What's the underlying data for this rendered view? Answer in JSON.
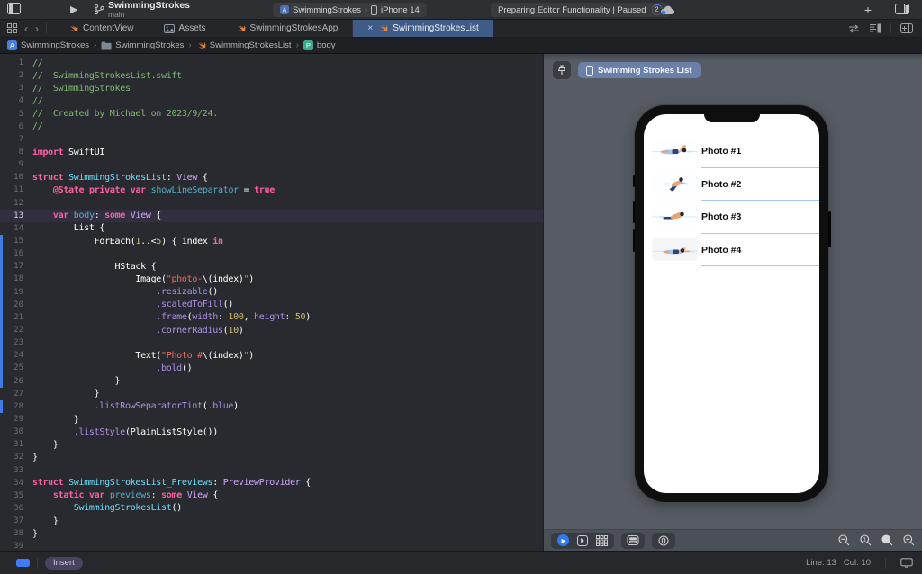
{
  "colors": {
    "accent": "#3e7bf5",
    "active_tab": "#3e5c86",
    "row_separator": "#a3c6f2",
    "swift_orange": "#e8833a"
  },
  "toolbar": {
    "project_title": "SwimmingStrokes",
    "branch": "main",
    "scheme": {
      "target": "SwimmingStrokes",
      "device": "iPhone 14"
    },
    "status": {
      "text": "Preparing Editor Functionality | Paused",
      "badge": "2"
    },
    "plus_label": "+"
  },
  "tabs": [
    {
      "label": "ContentView",
      "icon": "swift-icon",
      "active": false
    },
    {
      "label": "Assets",
      "icon": "assets-icon",
      "active": false
    },
    {
      "label": "SwimmingStrokesApp",
      "icon": "swift-icon",
      "active": false
    },
    {
      "label": "SwimmingStrokesList",
      "icon": "swift-icon",
      "active": true,
      "closable": true
    }
  ],
  "breadcrumb": [
    {
      "label": "SwimmingStrokes",
      "icon": "project-icon"
    },
    {
      "label": "SwimmingStrokes",
      "icon": "folder-icon"
    },
    {
      "label": "SwimmingStrokesList",
      "icon": "swift-icon"
    },
    {
      "label": "body",
      "icon": "property-icon"
    }
  ],
  "editor": {
    "current_line": 13,
    "changed_lines": [
      15,
      16,
      17,
      18,
      19,
      20,
      21,
      22,
      23,
      24,
      25,
      26,
      28
    ],
    "lines": [
      [
        [
          "c",
          "//"
        ]
      ],
      [
        [
          "c",
          "//  SwimmingStrokesList.swift"
        ]
      ],
      [
        [
          "c",
          "//  SwimmingStrokes"
        ]
      ],
      [
        [
          "c",
          "//"
        ]
      ],
      [
        [
          "c",
          "//  Created by Michael on 2023/9/24."
        ]
      ],
      [
        [
          "c",
          "//"
        ]
      ],
      [],
      [
        [
          "k",
          "import"
        ],
        [
          "w",
          " SwiftUI"
        ]
      ],
      [],
      [
        [
          "k",
          "struct"
        ],
        [
          "w",
          " "
        ],
        [
          "pt",
          "SwimmingStrokesList"
        ],
        [
          "w",
          ": "
        ],
        [
          "t",
          "View"
        ],
        [
          "w",
          " {"
        ]
      ],
      [
        [
          "w",
          "    "
        ],
        [
          "k",
          "@State"
        ],
        [
          "w",
          " "
        ],
        [
          "k",
          "private"
        ],
        [
          "w",
          " "
        ],
        [
          "k",
          "var"
        ],
        [
          "w",
          " "
        ],
        [
          "pr",
          "showLineSeparator"
        ],
        [
          "w",
          " = "
        ],
        [
          "k",
          "true"
        ]
      ],
      [],
      [
        [
          "w",
          "    "
        ],
        [
          "k",
          "var"
        ],
        [
          "w",
          " "
        ],
        [
          "pr",
          "body"
        ],
        [
          "w",
          ": "
        ],
        [
          "k",
          "some"
        ],
        [
          "w",
          " "
        ],
        [
          "t",
          "View"
        ],
        [
          "w",
          " {"
        ]
      ],
      [
        [
          "w",
          "        List {"
        ]
      ],
      [
        [
          "w",
          "            ForEach("
        ],
        [
          "n",
          "1"
        ],
        [
          "w",
          "..<"
        ],
        [
          "n",
          "5"
        ],
        [
          "w",
          ") { index "
        ],
        [
          "k",
          "in"
        ]
      ],
      [],
      [
        [
          "w",
          "                HStack {"
        ]
      ],
      [
        [
          "w",
          "                    Image("
        ],
        [
          "s",
          "\"photo-"
        ],
        [
          "w",
          "\\(index)"
        ],
        [
          "s",
          "\""
        ],
        [
          "w",
          ")"
        ]
      ],
      [
        [
          "w",
          "                        "
        ],
        [
          "m",
          ".resizable"
        ],
        [
          "w",
          "()"
        ]
      ],
      [
        [
          "w",
          "                        "
        ],
        [
          "m",
          ".scaledToFill"
        ],
        [
          "w",
          "()"
        ]
      ],
      [
        [
          "w",
          "                        "
        ],
        [
          "m",
          ".frame"
        ],
        [
          "w",
          "("
        ],
        [
          "m",
          "width"
        ],
        [
          "w",
          ": "
        ],
        [
          "n",
          "100"
        ],
        [
          "w",
          ", "
        ],
        [
          "m",
          "height"
        ],
        [
          "w",
          ": "
        ],
        [
          "n",
          "50"
        ],
        [
          "w",
          ")"
        ]
      ],
      [
        [
          "w",
          "                        "
        ],
        [
          "m",
          ".cornerRadius"
        ],
        [
          "w",
          "("
        ],
        [
          "n",
          "10"
        ],
        [
          "w",
          ")"
        ]
      ],
      [],
      [
        [
          "w",
          "                    Text("
        ],
        [
          "s",
          "\"Photo #"
        ],
        [
          "w",
          "\\(index)"
        ],
        [
          "s",
          "\""
        ],
        [
          "w",
          ")"
        ]
      ],
      [
        [
          "w",
          "                        "
        ],
        [
          "m",
          ".bold"
        ],
        [
          "w",
          "()"
        ]
      ],
      [
        [
          "w",
          "                }"
        ]
      ],
      [
        [
          "w",
          "            }"
        ]
      ],
      [
        [
          "w",
          "            "
        ],
        [
          "m",
          ".listRowSeparatorTint"
        ],
        [
          "w",
          "("
        ],
        [
          "m",
          ".blue"
        ],
        [
          "w",
          ")"
        ]
      ],
      [
        [
          "w",
          "        }"
        ]
      ],
      [
        [
          "w",
          "        "
        ],
        [
          "m",
          ".listStyle"
        ],
        [
          "w",
          "(PlainListStyle())"
        ]
      ],
      [
        [
          "w",
          "    }"
        ]
      ],
      [
        [
          "w",
          "}"
        ]
      ],
      [],
      [
        [
          "k",
          "struct"
        ],
        [
          "w",
          " "
        ],
        [
          "pt",
          "SwimmingStrokesList_Previews"
        ],
        [
          "w",
          ": "
        ],
        [
          "t",
          "PreviewProvider"
        ],
        [
          "w",
          " {"
        ]
      ],
      [
        [
          "w",
          "    "
        ],
        [
          "k",
          "static"
        ],
        [
          "w",
          " "
        ],
        [
          "k",
          "var"
        ],
        [
          "w",
          " "
        ],
        [
          "pr",
          "previews"
        ],
        [
          "w",
          ": "
        ],
        [
          "k",
          "some"
        ],
        [
          "w",
          " "
        ],
        [
          "t",
          "View"
        ],
        [
          "w",
          " {"
        ]
      ],
      [
        [
          "w",
          "        "
        ],
        [
          "pt",
          "SwimmingStrokesList"
        ],
        [
          "w",
          "()"
        ]
      ],
      [
        [
          "w",
          "    }"
        ]
      ],
      [
        [
          "w",
          "}"
        ]
      ],
      []
    ]
  },
  "preview": {
    "chip_label": "Swimming Strokes List",
    "device_name": "iPhone 14",
    "rows": [
      {
        "label": "Photo #1",
        "icon": "swimmer-backstroke"
      },
      {
        "label": "Photo #2",
        "icon": "swimmer-breaststroke"
      },
      {
        "label": "Photo #3",
        "icon": "swimmer-butterfly"
      },
      {
        "label": "Photo #4",
        "icon": "swimmer-freestyle"
      }
    ]
  },
  "statusbar": {
    "mode": "Insert",
    "line_label": "Line: 13",
    "col_label": "Col: 10"
  }
}
